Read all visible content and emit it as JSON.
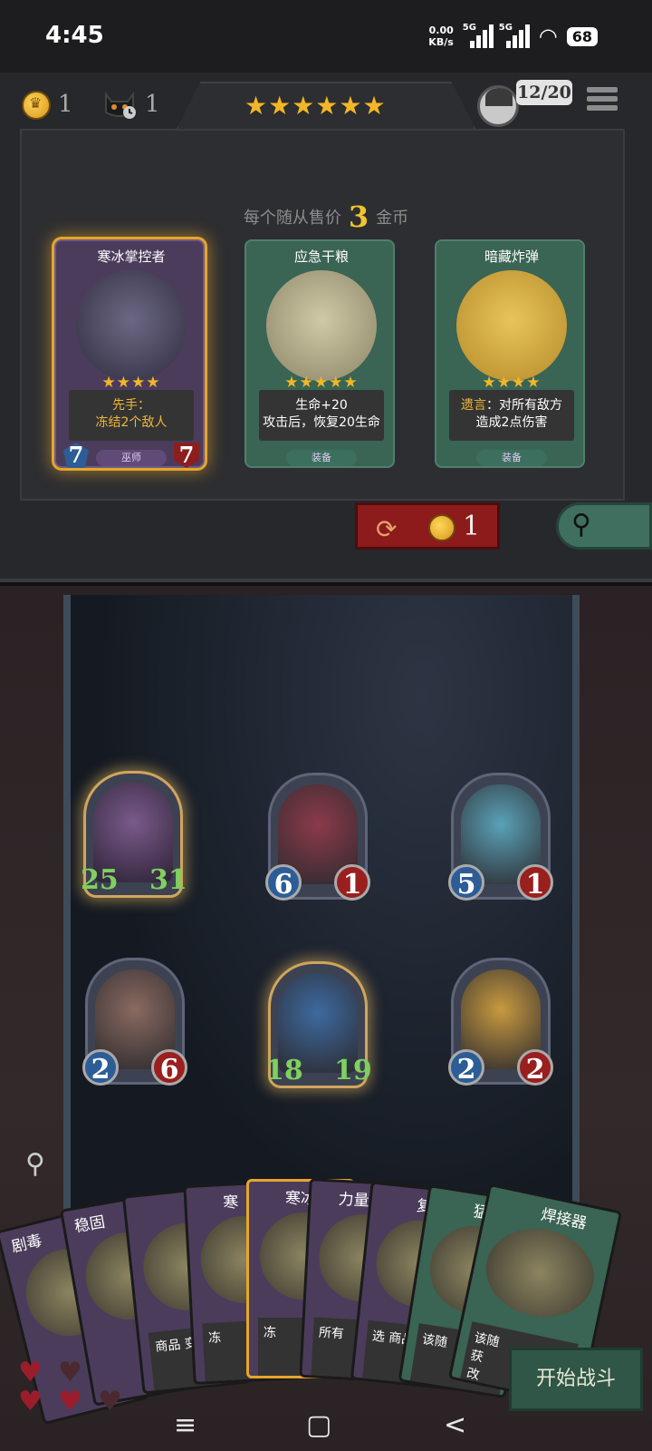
{
  "status_bar": {
    "time": "4:45",
    "net_speed_value": "0.00",
    "net_speed_unit": "KB/s",
    "sim1": "5G",
    "sim2": "5G",
    "battery": "68"
  },
  "shop": {
    "gold": "1",
    "timer_count": "1",
    "tier_stars": "★★★★★★",
    "tier_star_count": 6,
    "player_count": "12/20",
    "price_prefix": "每个随从售价",
    "price_value": "3",
    "price_suffix": "金币",
    "refresh_cost": "1",
    "cards": [
      {
        "name": "寒冰掌控者",
        "stars": "★★★★",
        "kw": "先手",
        "desc_line1": "：",
        "desc_line2": "冻结2个敌人",
        "tag": "巫师",
        "attack": "7",
        "health": "7"
      },
      {
        "name": "应急干粮",
        "stars": "★★★★★",
        "kw": "",
        "desc_line1": "生命+20",
        "desc_line2": "攻击后，恢复20生命",
        "tag": "装备"
      },
      {
        "name": "暗藏炸弹",
        "stars": "★★★★",
        "kw": "遗言",
        "desc_line1": "：对所有敌方",
        "desc_line2": "造成2点伤害",
        "tag": "装备"
      }
    ]
  },
  "board": {
    "units": [
      {
        "attack": "25",
        "health": "31"
      },
      {
        "attack": "6",
        "health": "1"
      },
      {
        "attack": "5",
        "health": "1"
      },
      {
        "attack": "2",
        "health": "6"
      },
      {
        "attack": "18",
        "health": "19"
      },
      {
        "attack": "2",
        "health": "2"
      }
    ]
  },
  "hand": [
    {
      "name": "剧毒",
      "desc": ""
    },
    {
      "name": "稳固",
      "desc": ""
    },
    {
      "name": "",
      "desc": "商品\n变为"
    },
    {
      "name": "寒",
      "desc": "冻"
    },
    {
      "name": "寒冰",
      "desc": "冻"
    },
    {
      "name": "力量",
      "desc": "所有"
    },
    {
      "name": "复",
      "desc": "选\n商品"
    },
    {
      "name": "猛",
      "desc": "该随"
    },
    {
      "name": "焊接器",
      "desc": "该随\n获\n改"
    }
  ],
  "lives": {
    "full": 3,
    "empty": 2
  },
  "start_battle_label": "开始战斗",
  "nav": {
    "menu": "≡",
    "home": "▢",
    "back": "<"
  }
}
